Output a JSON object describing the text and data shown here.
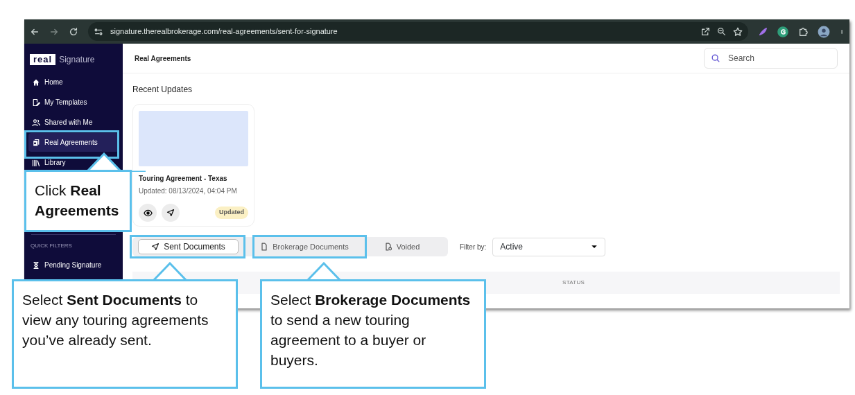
{
  "browser": {
    "url": "signature.therealbrokerage.com/real-agreements/sent-for-signature"
  },
  "sidebar": {
    "logo": "real",
    "brand": "Signature",
    "items": [
      {
        "label": "Home",
        "selected": false
      },
      {
        "label": "My Templates",
        "selected": false
      },
      {
        "label": "Shared with Me",
        "selected": false
      },
      {
        "label": "Real Agreements",
        "selected": true
      },
      {
        "label": "Library",
        "selected": false
      }
    ],
    "section": "QUICK FILTERS",
    "filters": [
      {
        "label": "Pending Signature"
      }
    ]
  },
  "header": {
    "title": "Real Agreements",
    "search": {
      "placeholder": "Search"
    }
  },
  "recent": {
    "title": "Recent Updates",
    "cards": [
      {
        "title": "Touring Agreement - Texas",
        "updated": "Updated: 08/13/2024, 04:04 PM",
        "badge": "Updated"
      }
    ]
  },
  "tabs": [
    {
      "label": "Sent Documents",
      "selected": true
    },
    {
      "label": "Brokerage Documents",
      "selected": false
    },
    {
      "label": "Voided",
      "selected": false
    }
  ],
  "filter": {
    "label": "Filter by:",
    "value": "Active"
  },
  "table": {
    "columns": [
      "STATUS"
    ]
  },
  "callouts": [
    {
      "text": "Click **Real Agreements**"
    },
    {
      "text": "Select **Sent Documents** to view any touring agreements you’ve already sent."
    },
    {
      "text": "Select **Brokerage Documents** to send a new touring agreement to a buyer or buyers."
    }
  ]
}
